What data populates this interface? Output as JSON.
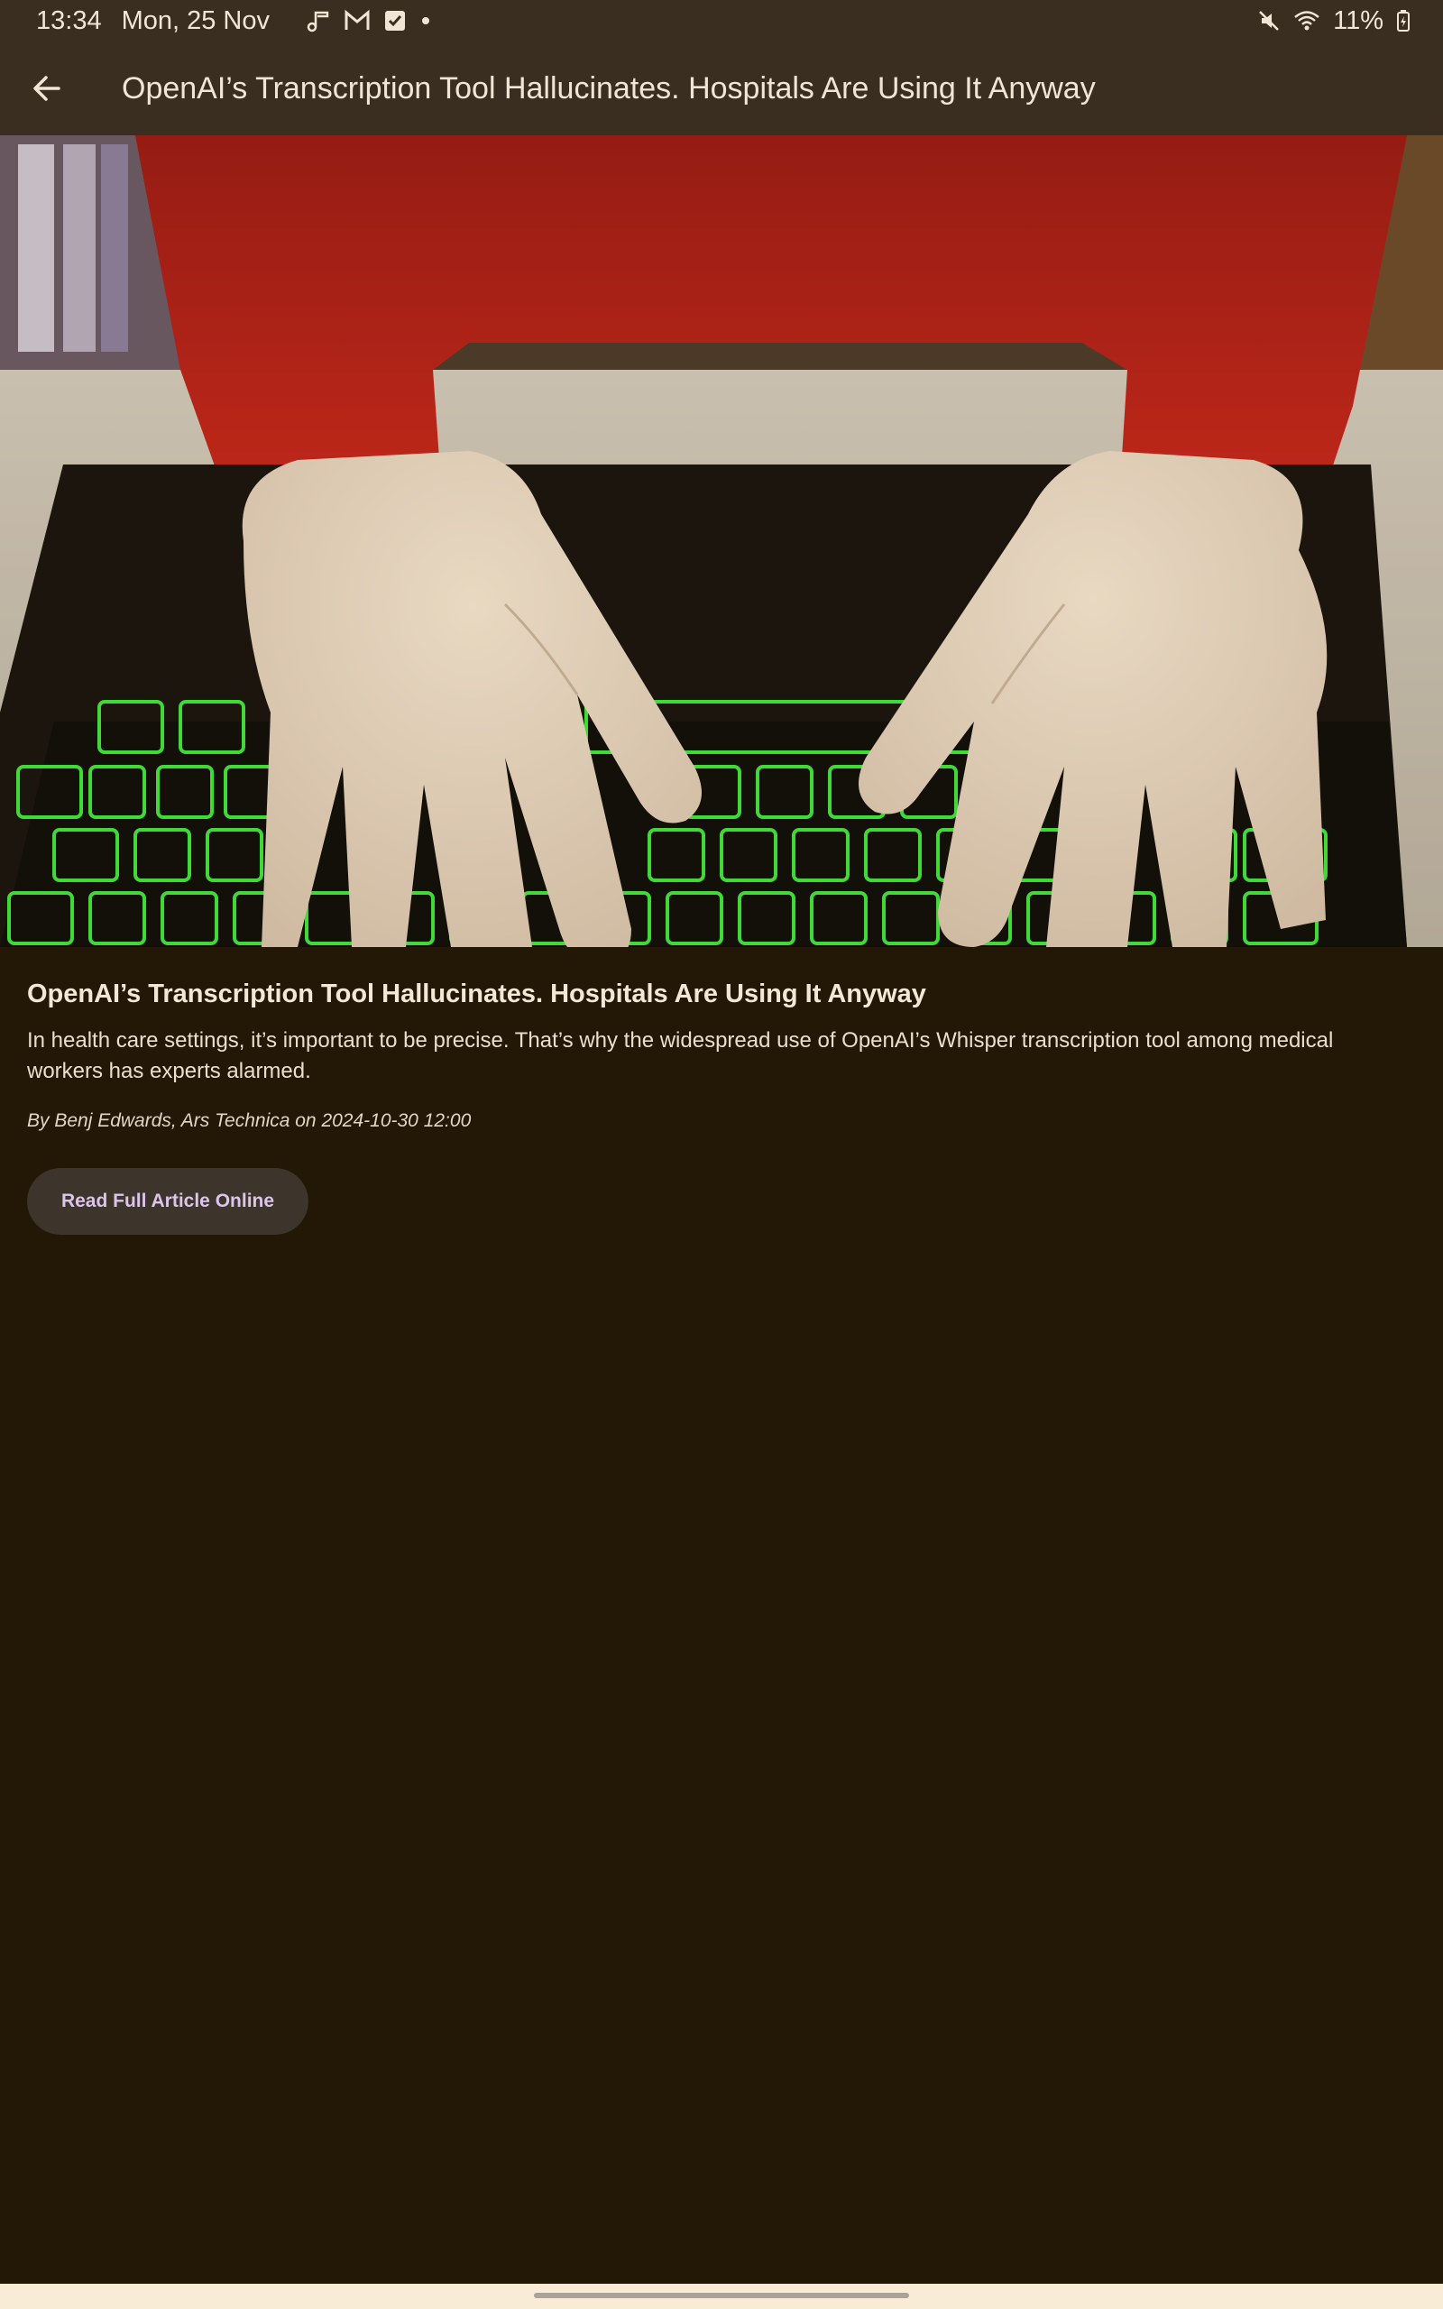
{
  "status_bar": {
    "time": "13:34",
    "date": "Mon, 25 Nov",
    "notification_icons": [
      "music-note-icon",
      "gmail-icon",
      "tasks-check-icon",
      "more-dot-icon"
    ],
    "battery": "11%",
    "system_icons": [
      "mute-icon",
      "wifi-icon",
      "battery-charging-icon"
    ]
  },
  "app_bar": {
    "title": "OpenAI’s Transcription Tool Hallucinates. Hospitals Are Using It Anyway",
    "back_icon": "arrow-back-icon"
  },
  "article": {
    "image_description_icon": "gloved-hands-on-keyboard-photo",
    "headline": "OpenAI’s Transcription Tool Hallucinates. Hospitals Are Using It Anyway",
    "summary": "In health care settings, it’s important to be precise. That’s why the widespread use of OpenAI’s Whisper transcription tool among medical workers has experts alarmed.",
    "byline": "By Benj Edwards, Ars Technica on 2024-10-30 12:00",
    "read_button_label": "Read Full Article Online"
  },
  "colors": {
    "background": "#221805",
    "app_bar": "#392e1f",
    "button_bg": "#3d342b",
    "button_text": "#dcc4ea",
    "nav_bar": "#f8ecd6"
  }
}
